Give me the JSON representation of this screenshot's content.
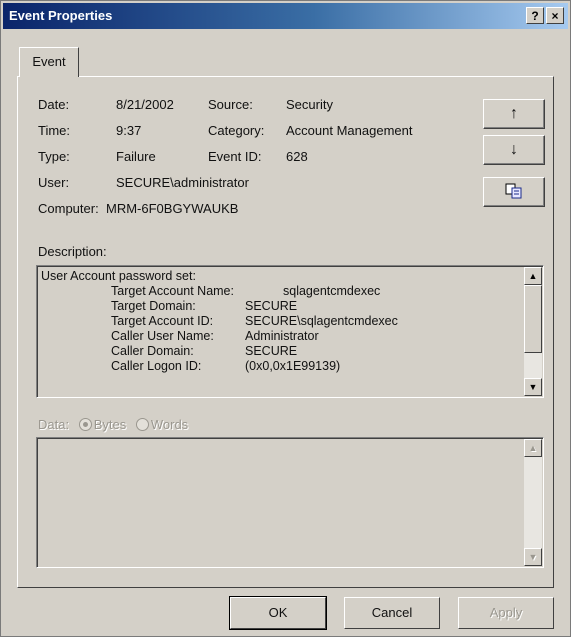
{
  "window": {
    "title": "Event Properties",
    "help_label": "?",
    "close_label": "×"
  },
  "tabs": [
    {
      "label": "Event"
    }
  ],
  "fields": {
    "date_label": "Date:",
    "date_value": "8/21/2002",
    "time_label": "Time:",
    "time_value": "9:37",
    "type_label": "Type:",
    "type_value": "Failure",
    "user_label": "User:",
    "user_value": "SECURE\\administrator",
    "computer_label": "Computer:",
    "computer_value": "MRM-6F0BGYWAUKB",
    "source_label": "Source:",
    "source_value": "Security",
    "category_label": "Category:",
    "category_value": "Account Management",
    "eventid_label": "Event ID:",
    "eventid_value": "628"
  },
  "side_buttons": {
    "up": "↑",
    "down": "↓",
    "copy": "copy-icon"
  },
  "description": {
    "label": "Description:",
    "header": "User Account password set:",
    "rows": [
      {
        "key": "Target Account Name:",
        "value": "sqlagentcmdexec"
      },
      {
        "key": "Target Domain:",
        "value": "SECURE"
      },
      {
        "key": "Target Account ID:",
        "value": "SECURE\\sqlagentcmdexec"
      },
      {
        "key": "Caller User Name:",
        "value": "Administrator"
      },
      {
        "key": "Caller Domain:",
        "value": "SECURE"
      },
      {
        "key": "Caller Logon ID:",
        "value": "(0x0,0x1E99139)"
      }
    ]
  },
  "data_section": {
    "label": "Data:",
    "bytes_label": "Bytes",
    "words_label": "Words",
    "selected": "Bytes"
  },
  "buttons": {
    "ok": "OK",
    "cancel": "Cancel",
    "apply": "Apply"
  }
}
